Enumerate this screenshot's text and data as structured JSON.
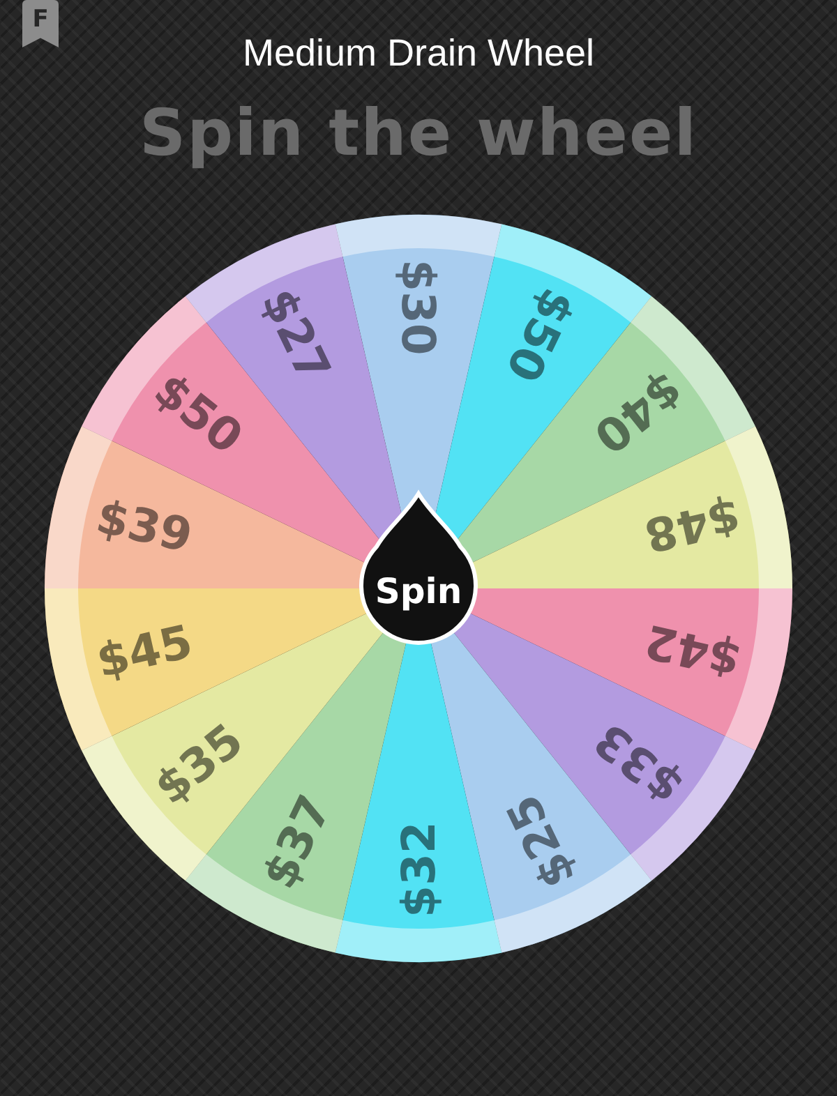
{
  "bookmark_badge": "F",
  "window": {
    "title": "Medium Drain Wheel"
  },
  "heading": "Spin the wheel",
  "wheel": {
    "segments": [
      {
        "label": "$30",
        "color": "#a9cdef"
      },
      {
        "label": "$50",
        "color": "#52e2f4"
      },
      {
        "label": "$40",
        "color": "#a7d8a6"
      },
      {
        "label": "$48",
        "color": "#e4e9a2"
      },
      {
        "label": "$42",
        "color": "#ef91ad"
      },
      {
        "label": "$33",
        "color": "#b39be0"
      },
      {
        "label": "$25",
        "color": "#a9cdef"
      },
      {
        "label": "$32",
        "color": "#52e2f4"
      },
      {
        "label": "$37",
        "color": "#a7d8a6"
      },
      {
        "label": "$35",
        "color": "#e4e9a2"
      },
      {
        "label": "$45",
        "color": "#f4d986"
      },
      {
        "label": "$39",
        "color": "#f5b89d"
      },
      {
        "label": "$50",
        "color": "#ef91ad"
      },
      {
        "label": "$27",
        "color": "#b39be0"
      }
    ],
    "spin_button": "Spin"
  }
}
